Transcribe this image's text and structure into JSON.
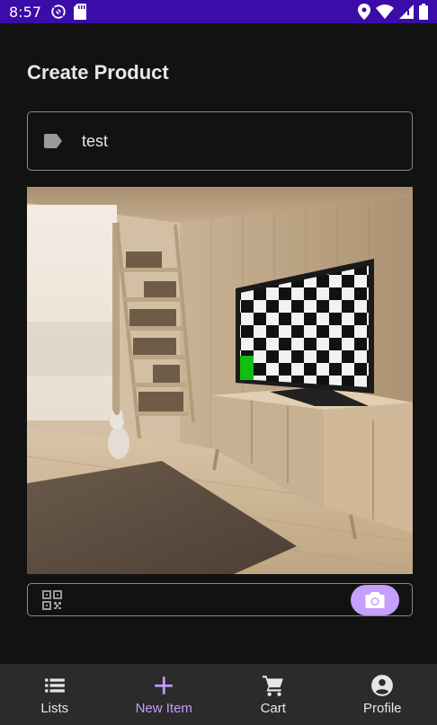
{
  "status": {
    "time": "8:57"
  },
  "page": {
    "title": "Create Product"
  },
  "form": {
    "name_value": "test",
    "barcode_value": ""
  },
  "nav": {
    "items": [
      {
        "label": "Lists",
        "icon": "list-icon"
      },
      {
        "label": "New Item",
        "icon": "plus-icon",
        "active": true
      },
      {
        "label": "Cart",
        "icon": "cart-icon"
      },
      {
        "label": "Profile",
        "icon": "account-icon"
      }
    ]
  },
  "colors": {
    "status_bar": "#3a0ca8",
    "background": "#121212",
    "accent": "#c79bff",
    "camera_button": "#c5a0ff"
  }
}
